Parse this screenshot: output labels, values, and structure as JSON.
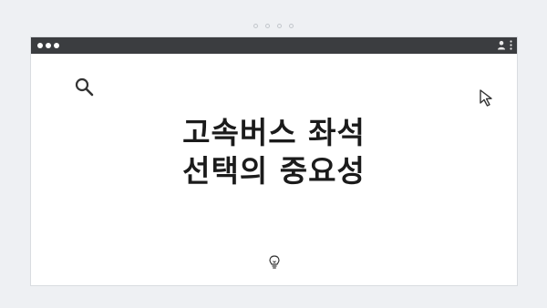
{
  "window": {
    "headline_line1": "고속버스 좌석",
    "headline_line2": "선택의 중요성"
  },
  "icons": {
    "window_controls": "traffic-light-dots",
    "account": "user-icon",
    "menu": "kebab-menu-icon",
    "search": "search-icon",
    "cursor": "cursor-arrow-icon",
    "bulb": "lightbulb-icon",
    "pager": "page-dots"
  },
  "colors": {
    "titlebar": "#3b3d40",
    "background": "#eef0f3",
    "text": "#1b1b1b"
  }
}
